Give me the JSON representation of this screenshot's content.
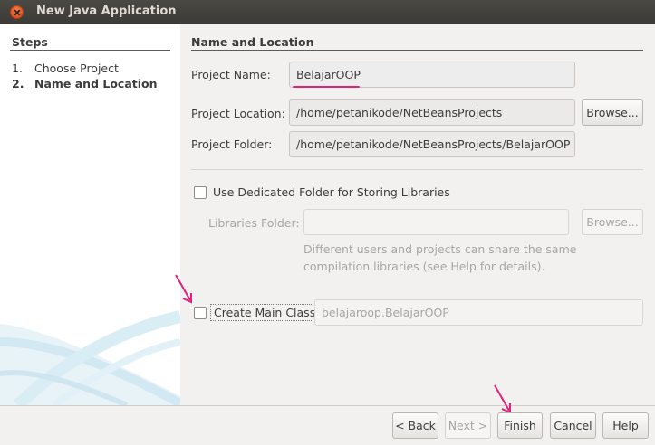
{
  "window": {
    "title": "New Java Application"
  },
  "steps": {
    "title": "Steps",
    "items": [
      {
        "num": "1.",
        "label": "Choose Project"
      },
      {
        "num": "2.",
        "label": "Name and Location"
      }
    ]
  },
  "section": {
    "title": "Name and Location"
  },
  "project_name": {
    "label": "Project Name:",
    "value": "BelajarOOP"
  },
  "project_location": {
    "label": "Project Location:",
    "value": "/home/petanikode/NetBeansProjects",
    "browse": "Browse..."
  },
  "project_folder": {
    "label": "Project Folder:",
    "value": "/home/petanikode/NetBeansProjects/BelajarOOP"
  },
  "libraries": {
    "checkbox_label": "Use Dedicated Folder for Storing Libraries",
    "folder_label": "Libraries Folder:",
    "folder_value": "",
    "browse": "Browse...",
    "hint_line1": "Different users and projects can share the same",
    "hint_line2": "compilation libraries (see Help for details)."
  },
  "main_class": {
    "checkbox_label": "Create Main Class",
    "value": "belajaroop.BelajarOOP"
  },
  "buttons": {
    "back": "< Back",
    "next": "Next >",
    "finish": "Finish",
    "cancel": "Cancel",
    "help": "Help"
  },
  "colors": {
    "accent": "#e0227a",
    "titlebar": "#3c3b37",
    "close": "#e0511f"
  }
}
